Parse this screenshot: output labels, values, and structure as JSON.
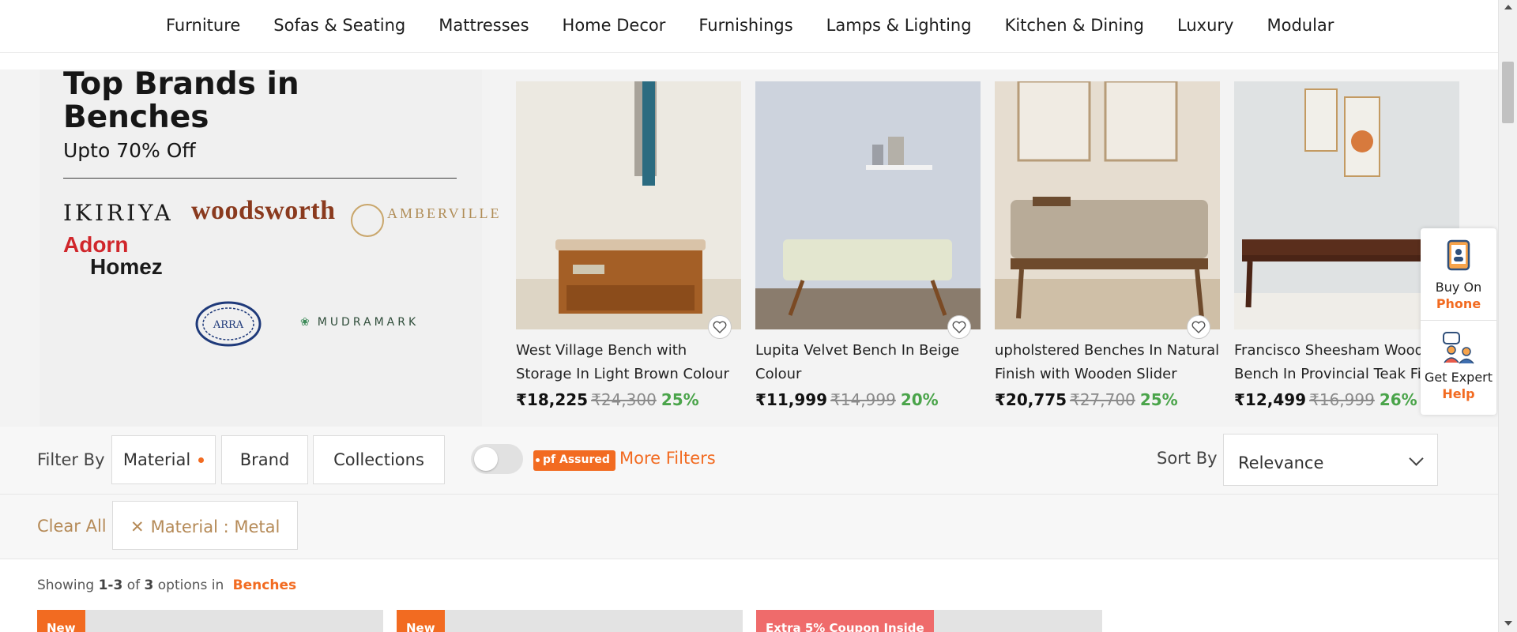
{
  "nav": {
    "items": [
      "Furniture",
      "Sofas & Seating",
      "Mattresses",
      "Home Decor",
      "Furnishings",
      "Lamps & Lighting",
      "Kitchen & Dining",
      "Luxury",
      "Modular"
    ]
  },
  "banner": {
    "title": "Top Brands in Benches",
    "subtitle": "Upto 70% Off",
    "brands": {
      "ikiriya": "IKIRIYA",
      "woodsworth": "woodsworth",
      "amberville": "AMBERVILLE",
      "adorn_line1": "Adorn",
      "adorn_line2": "Homez",
      "arra": "ARRA",
      "mudramark": "MUDRAMARK"
    }
  },
  "products": [
    {
      "name": "West Village Bench with Storage In Light Brown Colour",
      "price": "₹18,225",
      "mrp": "₹24,300",
      "discount": "25%"
    },
    {
      "name": "Lupita Velvet Bench In Beige Colour",
      "price": "₹11,999",
      "mrp": "₹14,999",
      "discount": "20%"
    },
    {
      "name": "upholstered Benches In Natural Finish with Wooden Slider",
      "price": "₹20,775",
      "mrp": "₹27,700",
      "discount": "25%"
    },
    {
      "name": "Francisco Sheesham Wood Bench In Provincial Teak Finish",
      "price": "₹12,499",
      "mrp": "₹16,999",
      "discount": "26%"
    }
  ],
  "help": {
    "buy_line1": "Buy On",
    "buy_line2": "Phone",
    "expert_line1": "Get Expert",
    "expert_line2": "Help"
  },
  "filters": {
    "label": "Filter By",
    "buttons": [
      "Material",
      "Brand",
      "Collections"
    ],
    "pf_assured": "pf Assured",
    "more": "More Filters",
    "sort_label": "Sort By",
    "sort_value": "Relevance"
  },
  "applied": {
    "clear_all": "Clear All",
    "chip": "Material : Metal"
  },
  "results": {
    "prefix": "Showing",
    "range": "1-3",
    "of": "of",
    "total": "3",
    "suffix": "options in",
    "category": "Benches"
  },
  "result_cards": [
    {
      "tag": "New"
    },
    {
      "tag": "New"
    },
    {
      "tag": "Extra 5% Coupon Inside"
    }
  ],
  "colors": {
    "accent": "#f26b21",
    "discount": "#4aa44a",
    "chip_text": "#b58a57"
  }
}
